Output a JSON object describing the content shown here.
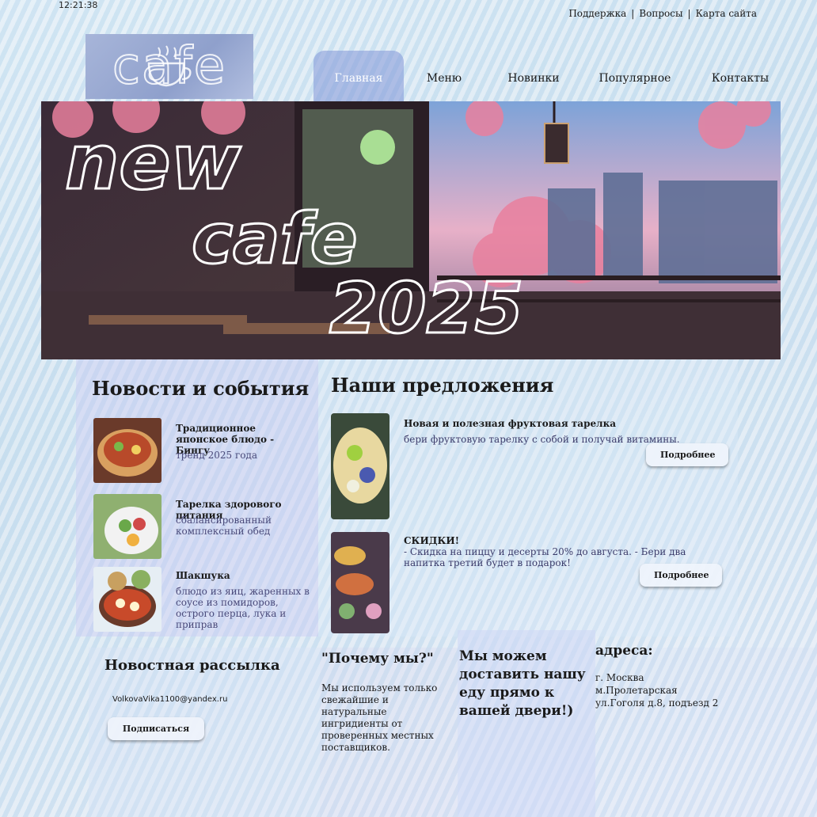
{
  "status": {
    "clock": "12:21:38"
  },
  "top_links": [
    "Поддержка",
    "Вопросы",
    "Карта сайта"
  ],
  "top_links_sep": "|",
  "logo": {
    "text": "cafe"
  },
  "nav": {
    "items": [
      "Главная",
      "Меню",
      "Новинки",
      "Популярное",
      "Контакты"
    ],
    "active": "Главная"
  },
  "banner": {
    "line1": "new",
    "line2": "cafe",
    "line3": "2025"
  },
  "news": {
    "heading": "Новости и события",
    "items": [
      {
        "title": "Традиционное японское блюдо - Бингу",
        "subtitle": "тренд 2025 года"
      },
      {
        "title": "Тарелка здорового питания",
        "subtitle": "сбалансированный комплексный обед"
      },
      {
        "title": "Шакшука",
        "subtitle": "блюдо из яиц, жаренных в соусе из помидоров, острого перца, лука и приправ"
      }
    ]
  },
  "offers": {
    "heading": "Наши предложения",
    "items": [
      {
        "title": "Новая и полезная фруктовая тарелка",
        "desc": "бери фруктовую тарелку с собой и получай витамины.",
        "button": "Подробнее"
      },
      {
        "title": "СКИДКИ!",
        "desc": "- Скидка на пиццу и десерты 20% до августа. - Бери два напитка третий будет в подарок!",
        "button": "Подробнее"
      }
    ]
  },
  "newsletter": {
    "heading": "Новостная рассылка",
    "email": "VolkovaVika1100@yandex.ru",
    "button": "Подписаться"
  },
  "why": {
    "heading": "\"Почему мы?\"",
    "text": "Мы используем только свежайшие и натуральные ингридиенты от проверенных местных поставщиков."
  },
  "delivery": {
    "text": "Мы можем доставить нашу еду прямо к вашей двери!)"
  },
  "address": {
    "heading": "адреса:",
    "text": "г. Москва м.Пролетарская ул.Гоголя д.8, подъезд 2"
  },
  "colors": {
    "nav_active": "#8296d7",
    "panel": "#cdcdf5"
  },
  "icons": [
    "coffee-cup-icon"
  ]
}
